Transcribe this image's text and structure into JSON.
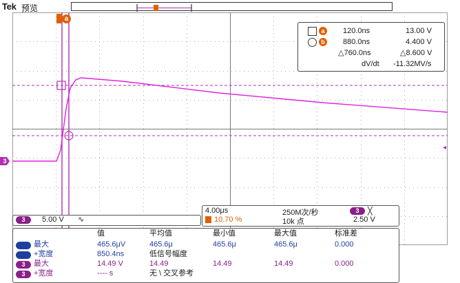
{
  "header": {
    "brand": "Tek",
    "mode": "预览"
  },
  "trigger": {
    "cursor_a_label": "a",
    "cursor_b_label": "b",
    "ch_marker_label": "3",
    "right_marker": "◂"
  },
  "cursors": {
    "row_a": {
      "time": "120.0ns",
      "volt": "13.00 V",
      "badge": "a"
    },
    "row_b": {
      "time": "880.0ns",
      "volt": "4.400 V",
      "badge": "b"
    },
    "delta": {
      "time": "△760.0ns",
      "volt": "△8.600 V"
    },
    "slope": {
      "label": "dV/dt",
      "value": "-11.32MV/s"
    }
  },
  "timebase": {
    "scale": "4.00μs",
    "rate": "250M次/秒",
    "trig_ch": "3",
    "trig_symbol": "╳",
    "trig_pos": "10.70 %",
    "record": "10k 点",
    "trig_level": "2.50 V"
  },
  "channel": {
    "num": "3",
    "scale": "5.00 V",
    "coupling": "∿"
  },
  "measurements": {
    "headers": [
      "值",
      "平均值",
      "最小值",
      "最大值",
      "标准差"
    ],
    "rows": [
      {
        "ch": "1",
        "color": "blue",
        "name": "最大",
        "v1": "465.6μV",
        "v2": "465.6μ",
        "v3": "465.6μ",
        "v4": "465.6μ",
        "v5": "0.000"
      },
      {
        "ch": "1",
        "color": "blue",
        "name": "+宽度",
        "v1": "850.4ns",
        "v2": "低信号幅度",
        "v3": "",
        "v4": "",
        "v5": ""
      },
      {
        "ch": "3",
        "color": "purple",
        "name": "最大",
        "v1": "14.49 V",
        "v2": "14.49",
        "v3": "14.49",
        "v4": "14.49",
        "v5": "0.000"
      },
      {
        "ch": "3",
        "color": "purple",
        "name": "+宽度",
        "v1": "---- s",
        "v2": "无 \\ 交叉参考",
        "v3": "",
        "v4": "",
        "v5": ""
      }
    ]
  },
  "colors": {
    "trace": "#e020e0",
    "cursor": "#b030b0",
    "grid": "#9a9a9a",
    "accent": "#e06000"
  }
}
